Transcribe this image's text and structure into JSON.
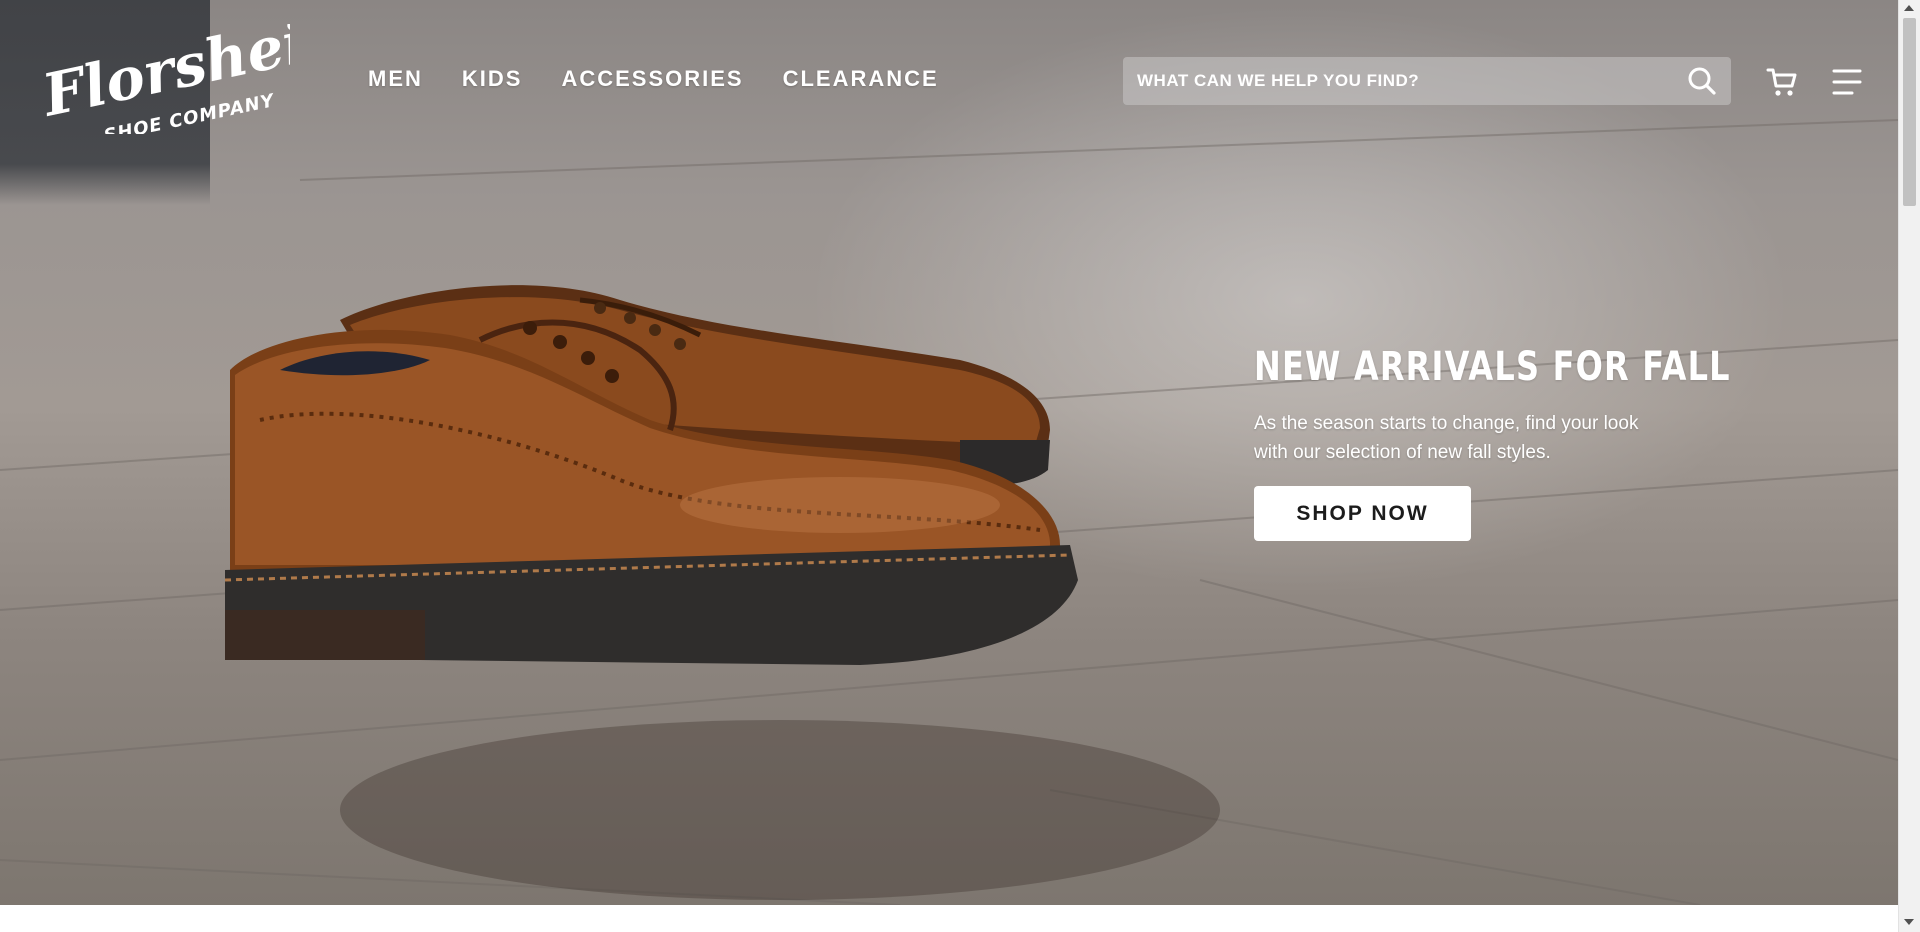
{
  "brand": {
    "logo_script": "Florsheim",
    "logo_sub": "SHOE COMPANY"
  },
  "nav": {
    "items": [
      {
        "label": "MEN"
      },
      {
        "label": "KIDS"
      },
      {
        "label": "ACCESSORIES"
      },
      {
        "label": "CLEARANCE"
      }
    ]
  },
  "search": {
    "placeholder": "WHAT CAN WE HELP YOU FIND?",
    "value": "",
    "icon": "search-icon"
  },
  "header_icons": {
    "cart": "cart-icon",
    "menu": "hamburger-menu-icon"
  },
  "hero": {
    "title": "NEW ARRIVALS FOR FALL",
    "description": "As the season starts to change, find your look with our selection of new fall styles.",
    "cta_label": "SHOP NOW",
    "image": "brown-leather-wingtip-shoes-on-wood-floor"
  },
  "colors": {
    "hero_text": "#ffffff",
    "cta_bg": "#ffffff",
    "cta_text": "#1c1c1c",
    "shoe_leather": "#8a4a1e"
  }
}
